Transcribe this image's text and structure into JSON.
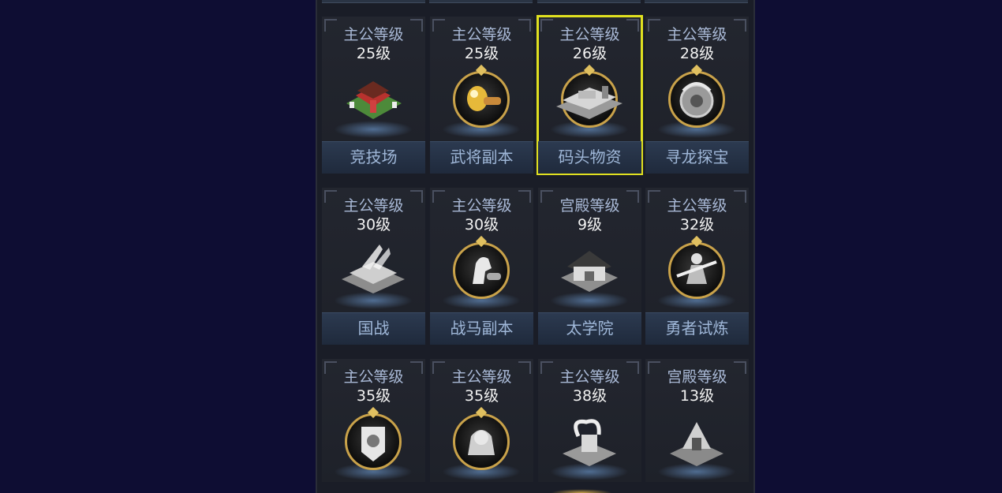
{
  "features": [
    {
      "req_type": "主公等级",
      "req_level": "25级",
      "name": "竞技场",
      "icon": "arena-icon",
      "selected": false
    },
    {
      "req_type": "主公等级",
      "req_level": "25级",
      "name": "武将副本",
      "icon": "general-dungeon-icon",
      "selected": false
    },
    {
      "req_type": "主公等级",
      "req_level": "26级",
      "name": "码头物资",
      "icon": "dock-supplies-icon",
      "selected": true
    },
    {
      "req_type": "主公等级",
      "req_level": "28级",
      "name": "寻龙探宝",
      "icon": "dragon-treasure-icon",
      "selected": false
    },
    {
      "req_type": "主公等级",
      "req_level": "30级",
      "name": "国战",
      "icon": "national-war-icon",
      "selected": false
    },
    {
      "req_type": "主公等级",
      "req_level": "30级",
      "name": "战马副本",
      "icon": "warhorse-dungeon-icon",
      "selected": false
    },
    {
      "req_type": "宫殿等级",
      "req_level": "9级",
      "name": "太学院",
      "icon": "academy-icon",
      "selected": false
    },
    {
      "req_type": "主公等级",
      "req_level": "32级",
      "name": "勇者试炼",
      "icon": "hero-trial-icon",
      "selected": false
    },
    {
      "req_type": "主公等级",
      "req_level": "35级",
      "name": "",
      "icon": "banner-shield-icon",
      "selected": false
    },
    {
      "req_type": "主公等级",
      "req_level": "35级",
      "name": "",
      "icon": "lion-statue-icon",
      "selected": false
    },
    {
      "req_type": "主公等级",
      "req_level": "38级",
      "name": "",
      "icon": "dragon-altar-icon",
      "selected": false
    },
    {
      "req_type": "宫殿等级",
      "req_level": "13级",
      "name": "",
      "icon": "tower-icon",
      "selected": false
    }
  ],
  "colors": {
    "background": "#0e0d33",
    "panel": "#1a1d27",
    "selected_outline": "#e0e020",
    "icon_ring": "#c9a24a",
    "label": "#a9b9d6"
  }
}
